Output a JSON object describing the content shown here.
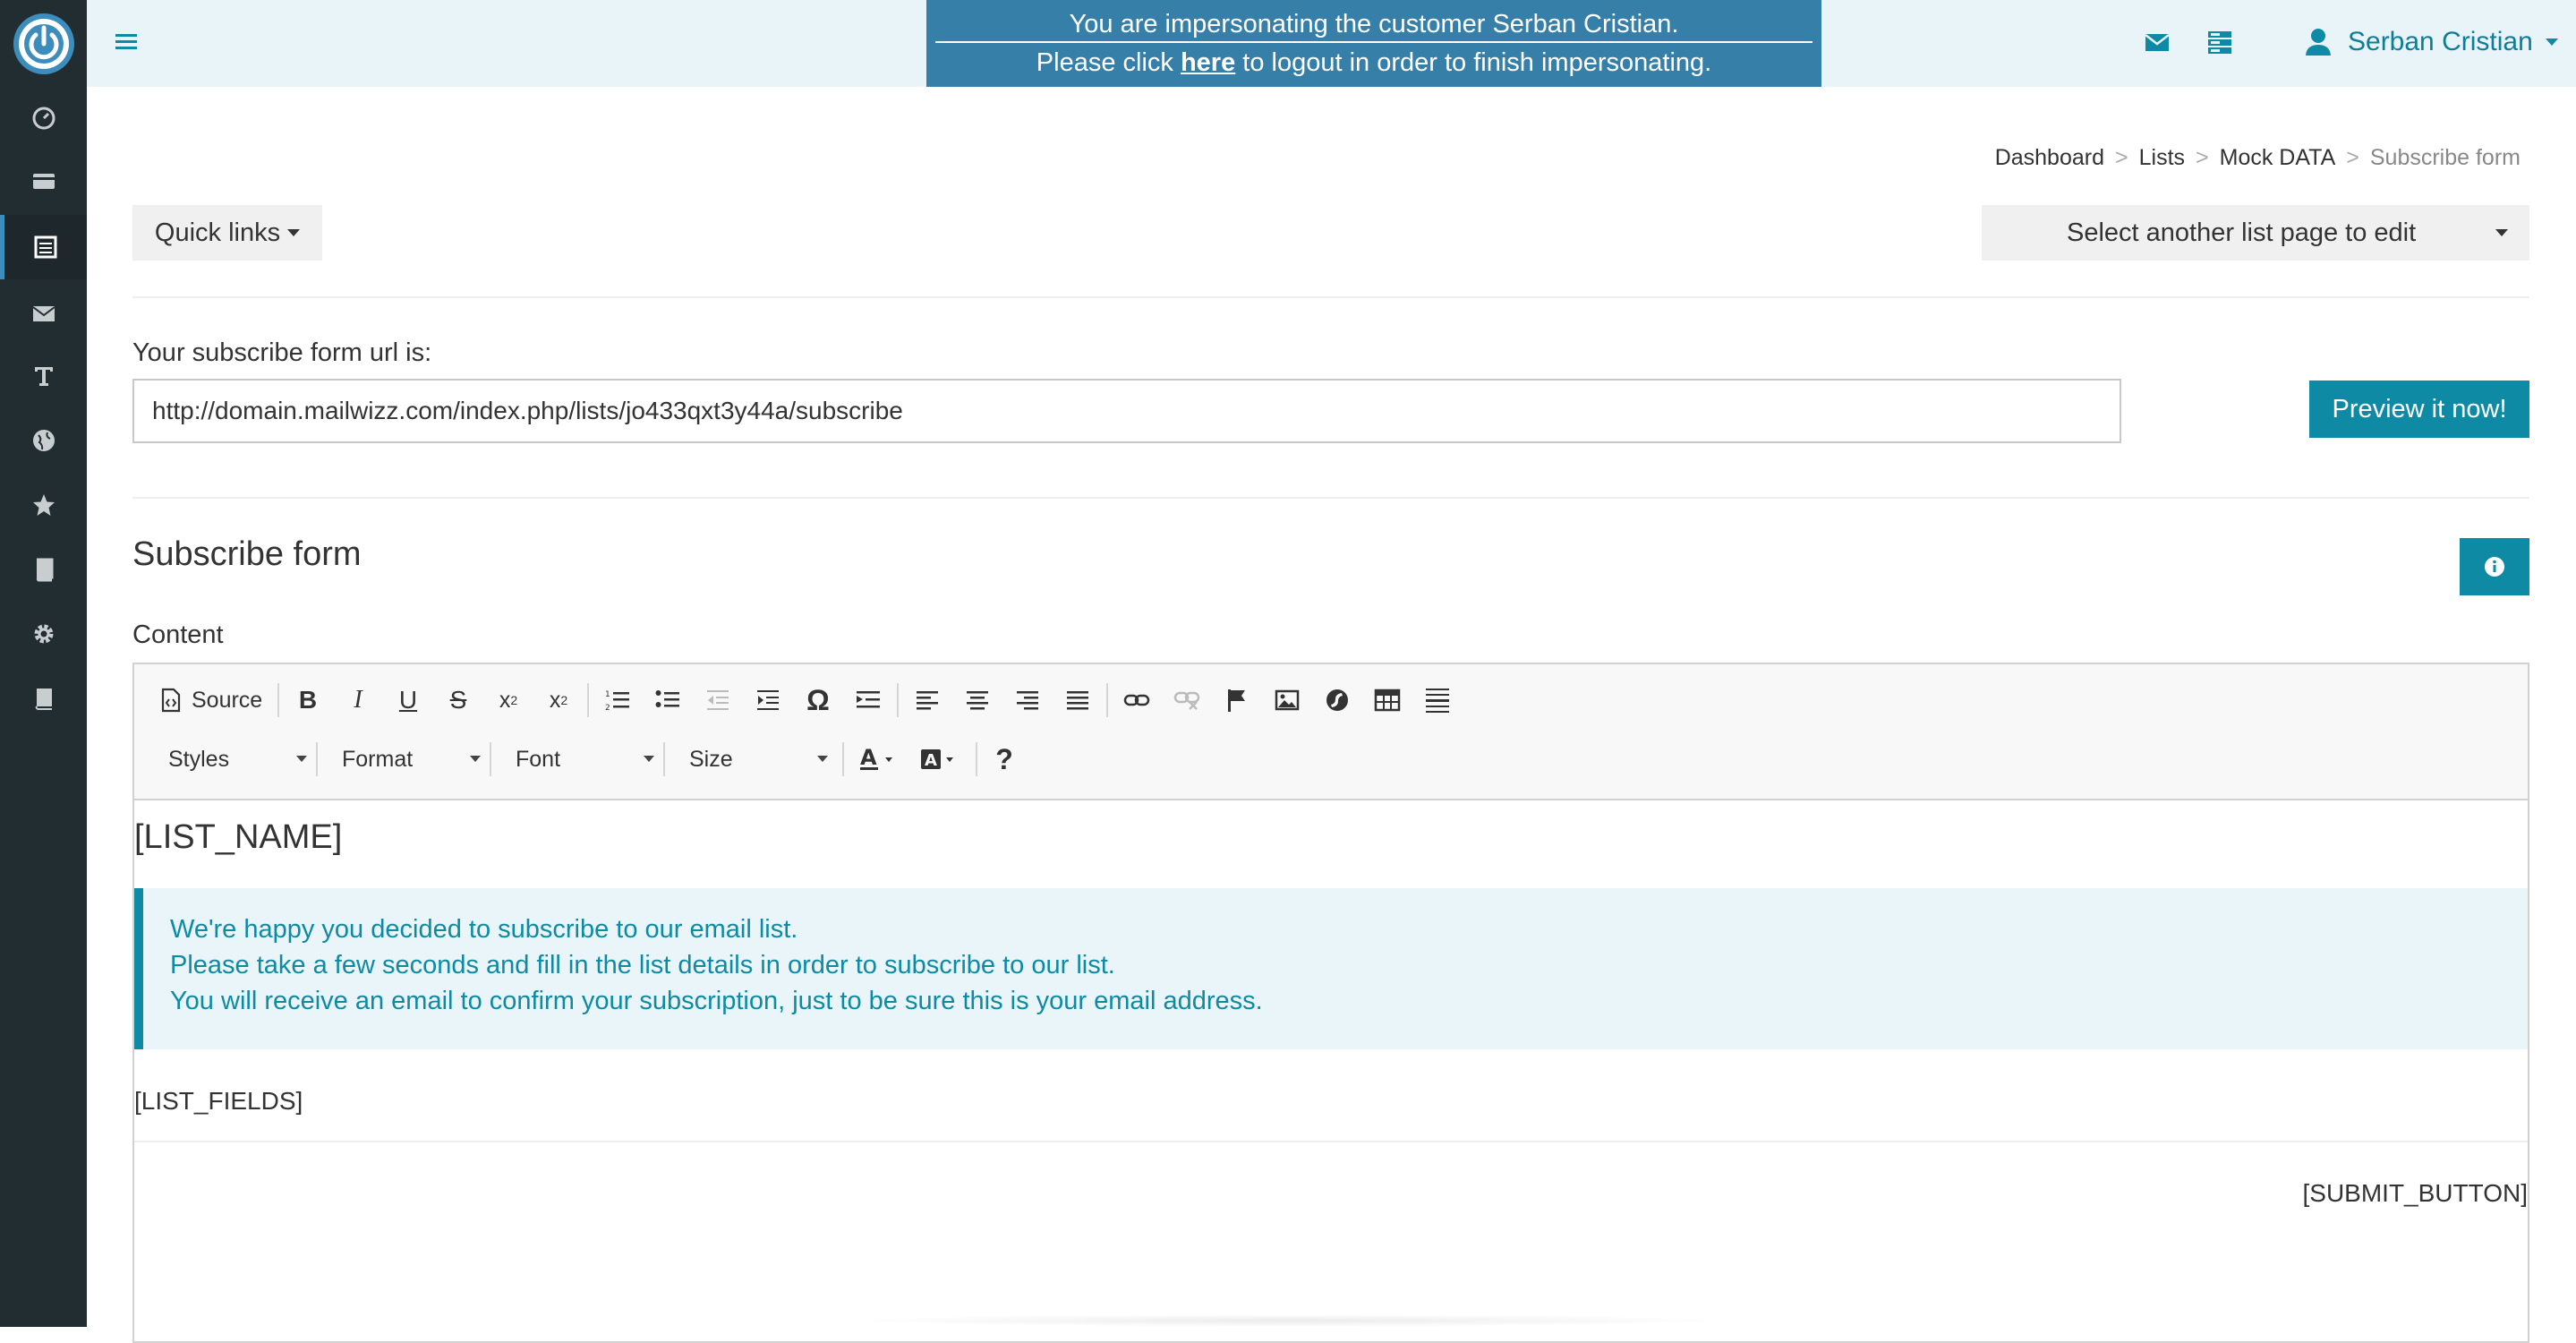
{
  "impersonation": {
    "line1": "You are impersonating the customer Serban Cristian.",
    "line2_pre": "Please click ",
    "line2_link": "here",
    "line2_post": " to logout in order to finish impersonating."
  },
  "header": {
    "user_name": "Serban Cristian"
  },
  "breadcrumb": {
    "items": [
      "Dashboard",
      "Lists",
      "Mock DATA"
    ],
    "current": "Subscribe form",
    "separator": ">"
  },
  "toolbar": {
    "quick_links": "Quick links",
    "select_list_page": "Select another list page to edit"
  },
  "url_section": {
    "label": "Your subscribe form url is:",
    "value": "http://domain.mailwizz.com/index.php/lists/jo433qxt3y44a/subscribe",
    "preview_button": "Preview it now!"
  },
  "form_section": {
    "title": "Subscribe form",
    "content_label": "Content"
  },
  "editor": {
    "source_label": "Source",
    "combos": {
      "styles": "Styles",
      "format": "Format",
      "font": "Font",
      "size": "Size"
    },
    "help": "?",
    "omega": "Ω",
    "content": {
      "list_name": "[LIST_NAME]",
      "callout_lines": [
        "We're happy you decided to subscribe to our email list.",
        "Please take a few seconds and fill in the list details in order to subscribe to our list.",
        "You will receive an email to confirm your subscription, just to be sure this is your email address."
      ],
      "list_fields": "[LIST_FIELDS]",
      "submit_button": "[SUBMIT_BUTTON]"
    }
  },
  "colors": {
    "sidebar": "#222d32",
    "accent": "#0f8aa4",
    "impersonate_bg": "#367fa9",
    "topbar": "#e8f4f7"
  }
}
